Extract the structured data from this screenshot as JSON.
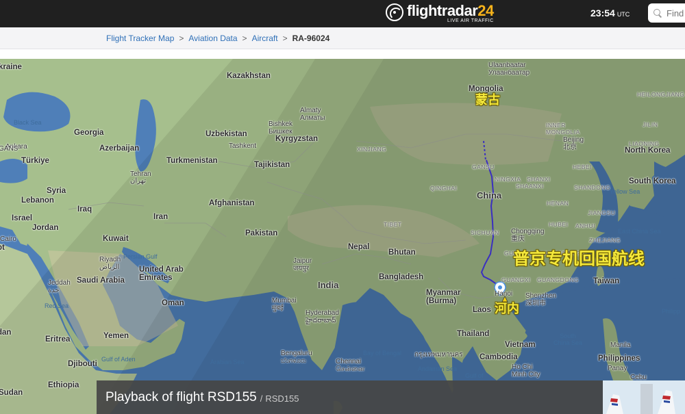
{
  "header": {
    "logo_text": "flightradar",
    "logo_number": "24",
    "logo_tagline": "LIVE AIR TRAFFIC",
    "time": "23:54",
    "time_zone": "UTC",
    "search_placeholder": "Find"
  },
  "breadcrumb": {
    "items": [
      "Flight Tracker Map",
      "Aviation Data",
      "Aircraft"
    ],
    "separator": ">",
    "current": "RA-96024"
  },
  "map": {
    "countries": {
      "ukraine": "kraine",
      "kazakhstan": "Kazakhstan",
      "mongolia": "Mongolia",
      "georgia": "Georgia",
      "uzbekistan": "Uzbekistan",
      "azerbaijan": "Azerbaijan",
      "kyrgyzstan": "Kyrgyzstan",
      "turkiye": "Türkiye",
      "turkmenistan": "Turkmenistan",
      "tajikistan": "Tajikistan",
      "syria": "Syria",
      "lebanon": "Lebanon",
      "iraq": "Iraq",
      "afghanistan": "Afghanistan",
      "iran": "Iran",
      "israel": "Israel",
      "jordan": "Jordan",
      "china": "China",
      "pakistan": "Pakistan",
      "kuwait": "Kuwait",
      "nepal": "Nepal",
      "bhutan": "Bhutan",
      "saudi_arabia": "Saudi Arabia",
      "uae": "United Arab\nEmirates",
      "bangladesh": "Bangladesh",
      "india": "India",
      "oman": "Oman",
      "myanmar": "Myanmar\n(Burma)",
      "laos": "Laos",
      "yemen": "Yemen",
      "eritrea": "Eritrea",
      "thailand": "Thailand",
      "vietnam": "Vietnam",
      "djibouti": "Djibouti",
      "cambodia": "Cambodia",
      "ethiopia": "Ethiopia",
      "sudan": "Sudan",
      "north_korea": "North Korea",
      "south_korea": "South Korea",
      "taiwan": "Taiwan",
      "philippines": "Philippines",
      "egypt_partial": "pt",
      "dan": "dan"
    },
    "cities": {
      "ulaanbaatar": "Ulaanbaatar\nУлаанбаатар",
      "almaty": "Almaty\nАлматы",
      "bishkek": "Bishkek\nБишкек",
      "tashkent": "Tashkent",
      "ankara": "Ankara",
      "gans": "GANS",
      "tehran": "Tehran\nتهران",
      "beijing": "Beijing\n北京",
      "cairo": "Cairo",
      "riyadh": "Riyadh\nالرياض",
      "jaipur": "Jaipur\nजयपुर",
      "jeddah": "Jeddah\nجدة",
      "chongqing": "Chongqing\n重庆",
      "mumbai": "Mumbai\nमुंबई",
      "hyderabad": "Hyderabad\nహైదరాబాద్",
      "shenzhen": "Shenzhen\n深圳市",
      "hanoi": "Hanoi",
      "bangkok": "กรุงเทพมหานคร",
      "bengaluru": "Bengaluru\nಬೆಂಗಳೂರು",
      "chennai": "Chennai\nசென்னை",
      "ho_chi_minh": "Ho Chi\nMinh City",
      "manila": "Manila",
      "panay": "Panay",
      "cebu": "Cebu"
    },
    "provinces": {
      "xinjiang": "XINJIANG",
      "gansu": "GANSU",
      "ningxia": "NINGXIA",
      "inner_mongolia": "INNER\nMONGOLIA",
      "shanxi": "SHANXI",
      "shandong": "SHANDONG",
      "qinghai": "QINGHAI",
      "shaanxi": "SHAANXI",
      "henan": "HENAN",
      "jiangsu": "JIANGSU",
      "tibet": "TIBET",
      "sichuan": "SICHUAN",
      "hubei": "HUBEI",
      "anhui": "ANHUI",
      "zhejiang": "ZHEJIANG",
      "hunan": "HUNAN",
      "jiangxi": "JIANGXI",
      "guizhou": "GUIZHOU",
      "fujian": "FUJIAN",
      "guangxi": "GUANGXI",
      "guangdong": "GUANGDONG",
      "liaoning": "LIAONING",
      "heilongjiang": "HEILONGJIANG",
      "hebei": "HEBEI",
      "jilin": "JILIN"
    },
    "seas": {
      "black_sea": "Black Sea",
      "persian_gulf": "Persian Gulf",
      "red_sea": "Red Sea",
      "gulf_of_aden": "Gulf of Aden",
      "arabian_sea": "Arabian Sea",
      "bay_of_bengal": "Bay of Bengal",
      "andaman_sea": "Andaman Sea",
      "south_china_sea": "South\nChina Sea",
      "east_china_sea": "East China Sea",
      "yellow_sea": "Yellow Sea",
      "gulf_of": "Gulf of",
      "philippine": "Philipp"
    },
    "annotations": {
      "mongolia_zh": "蒙古",
      "route_title_zh": "普京专机回国航线",
      "hanoi_zh": "河内"
    },
    "colors": {
      "route": "#3a2fc0",
      "annotation": "#f5e93b",
      "water": "#4f7fb8",
      "land": "#9cb784"
    }
  },
  "playback": {
    "title": "Playback of flight RSD155",
    "separator": "/",
    "code": "RSD155"
  }
}
